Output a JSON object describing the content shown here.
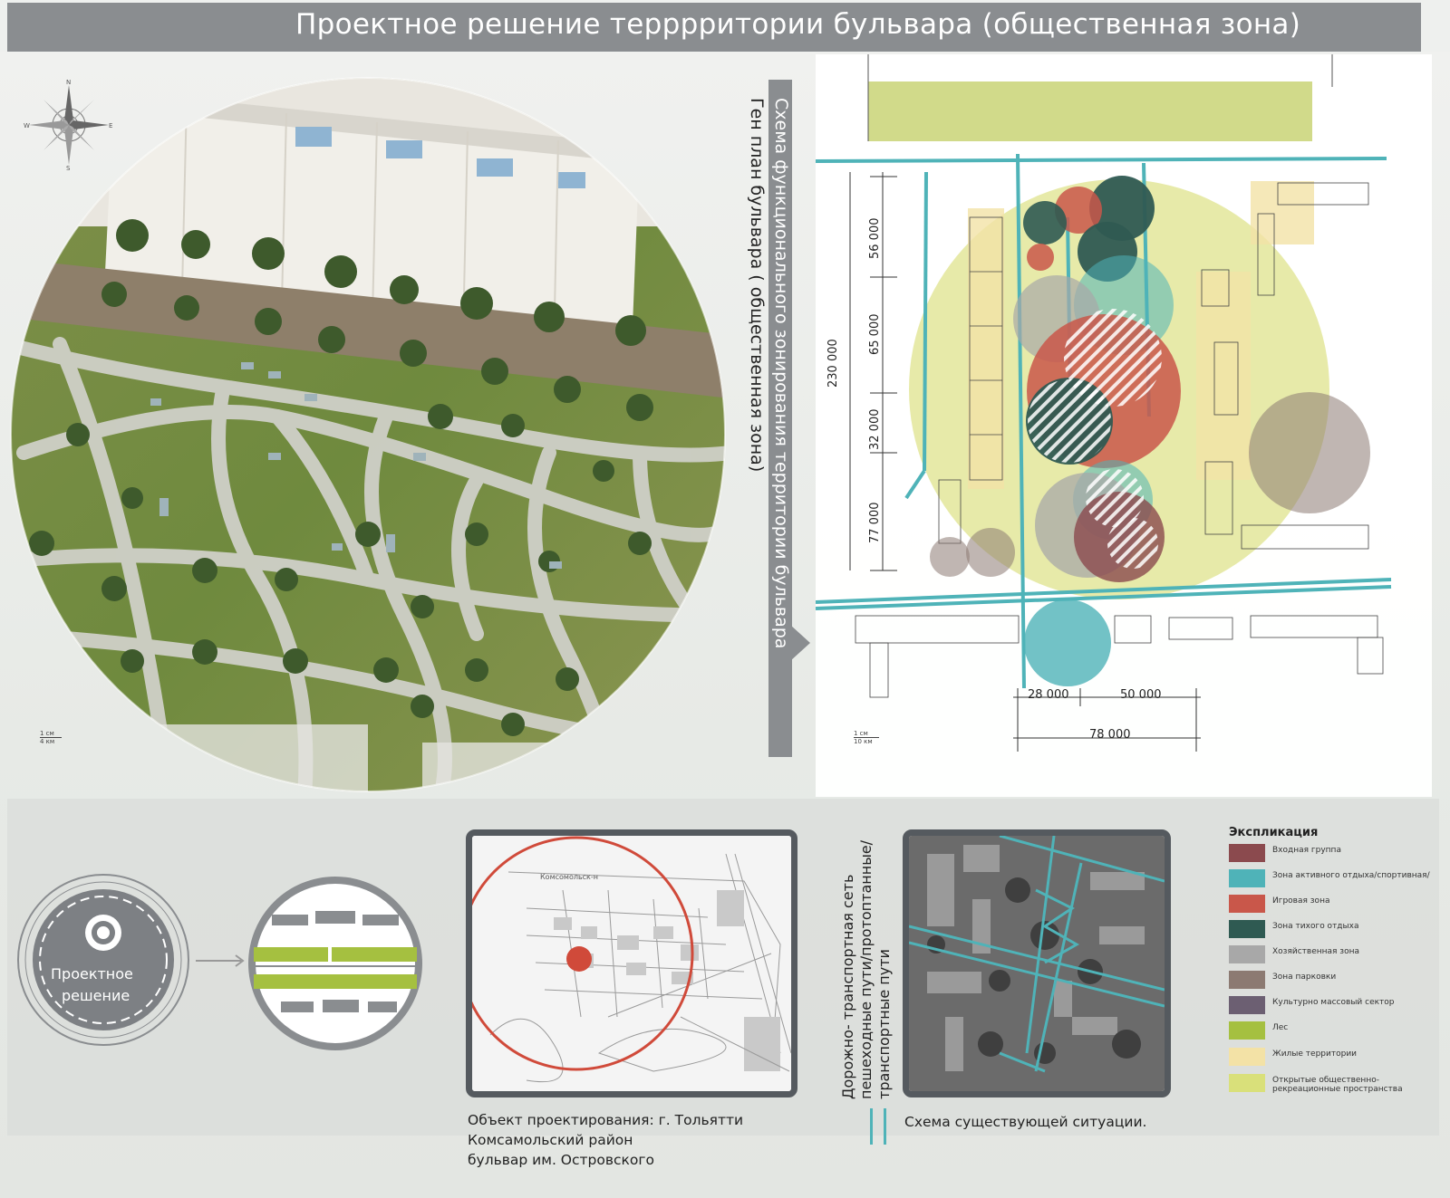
{
  "header": {
    "title": "Проектное решение терррритории бульвара (общественная зона)"
  },
  "vertical_labels": {
    "gen_plan": "Ген план бульвара ( общественная зона)",
    "zoning": "Схема функционального зонирования территории бульвара",
    "road_network_1": "Дорожно- транспортная сеть",
    "road_network_2": "пешеходные пути/протоптанные/",
    "road_network_3": "транспортные пути"
  },
  "scale_left": {
    "top": "1 см",
    "bottom": "4 км"
  },
  "scale_right": {
    "top": "1 см",
    "bottom": "10 км"
  },
  "dimensions": {
    "total_vertical": "230 000",
    "v1": "56 000",
    "v2": "65 000",
    "v3": "32 000",
    "v4": "77 000",
    "h1": "28 000",
    "h2": "50 000",
    "total_horizontal": "78 000"
  },
  "badge": {
    "line1": "Проектное",
    "line2": "решение"
  },
  "location_caption": {
    "line1": "Объект проектирования: г. Тольятти",
    "line2": "Комсамольский район",
    "line3": "бульвар им. Островского"
  },
  "map_label": "Комсомольск-н",
  "existing_caption": "Схема существующей ситуации.",
  "legend": {
    "title": "Экспликация",
    "items": [
      {
        "label": "Входная группа",
        "color": "#8b4a4e"
      },
      {
        "label": "Зона активного отдыха/спортивная/",
        "color": "#4fb3b8"
      },
      {
        "label": "Игровая зона",
        "color": "#c9574a"
      },
      {
        "label": "Зона тихого отдыха",
        "color": "#2f5a52"
      },
      {
        "label": "Хозяйственная зона",
        "color": "#a8a8a8"
      },
      {
        "label": "Зона парковки",
        "color": "#8c7a72"
      },
      {
        "label": "Культурно массовый сектор",
        "color": "#6c5f72"
      },
      {
        "label": "Лес",
        "color": "#a5c040"
      },
      {
        "label": " Жилые территории",
        "color": "#f3e2a6"
      },
      {
        "label": "Открытые общественно-рекреационные пространства",
        "color": "#d9e07a"
      }
    ]
  }
}
